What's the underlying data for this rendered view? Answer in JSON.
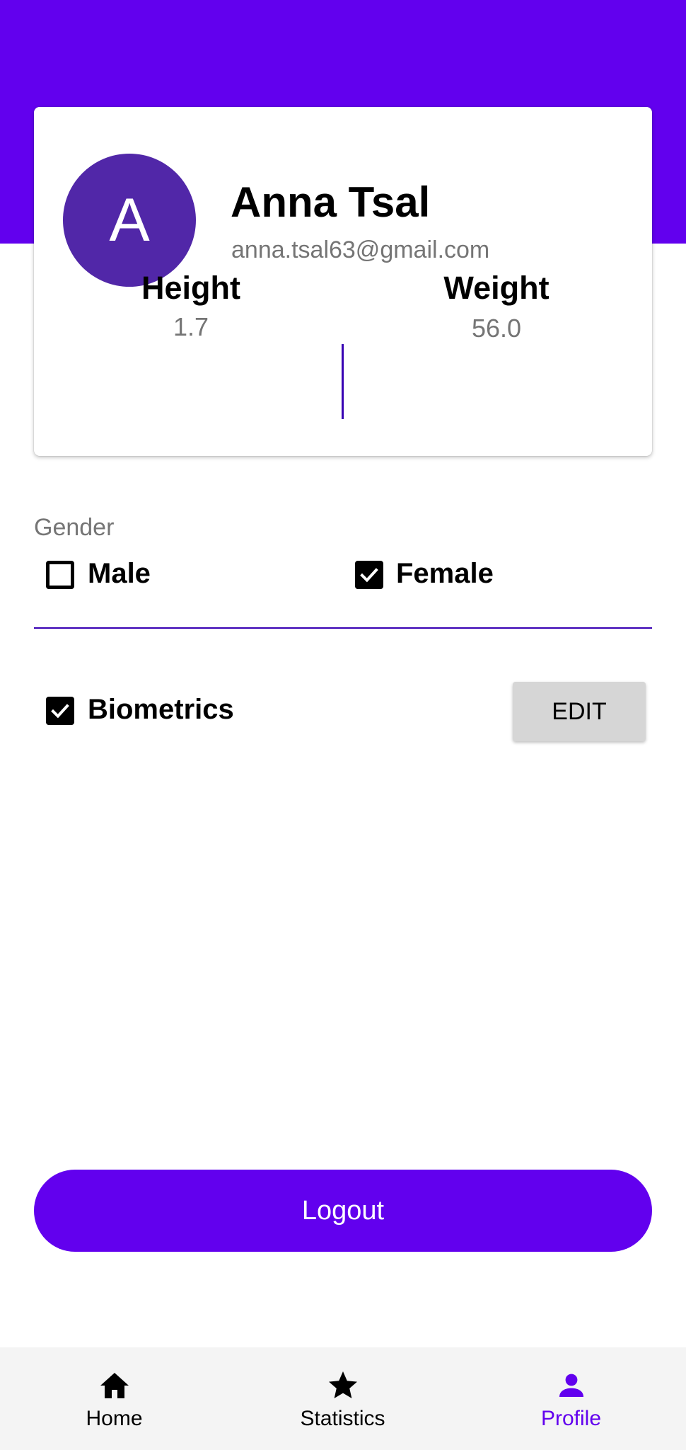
{
  "colors": {
    "primary": "#6200EE",
    "primary_dark": "#3700B3",
    "avatar_bg": "#5127A8",
    "secondary_text": "#757575",
    "button_gray": "#D6D6D6",
    "nav_bg": "#F4F4F4"
  },
  "profile": {
    "avatar_initial": "A",
    "name": "Anna Tsal",
    "email": "anna.tsal63@gmail.com"
  },
  "stats": {
    "height_label": "Height",
    "height_value": "1.7",
    "weight_label": "Weight",
    "weight_value": "56.0"
  },
  "gender": {
    "label": "Gender",
    "options": [
      {
        "label": "Male",
        "checked": false
      },
      {
        "label": "Female",
        "checked": true
      }
    ]
  },
  "biometrics": {
    "label": "Biometrics",
    "checked": true,
    "edit_label": "EDIT"
  },
  "logout_label": "Logout",
  "bottom_nav": {
    "items": [
      {
        "label": "Home",
        "icon": "home-icon",
        "active": false
      },
      {
        "label": "Statistics",
        "icon": "star-icon",
        "active": false
      },
      {
        "label": "Profile",
        "icon": "person-icon",
        "active": true
      }
    ]
  }
}
